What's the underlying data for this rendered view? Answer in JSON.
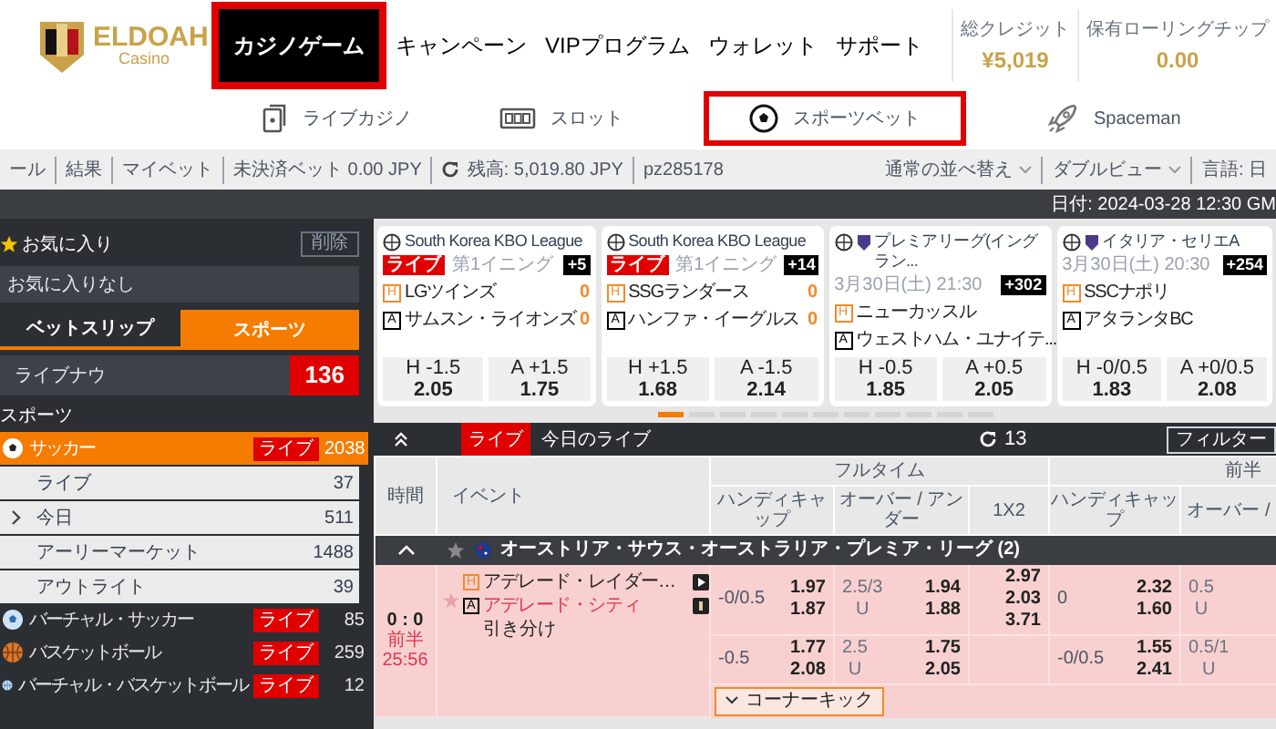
{
  "header": {
    "logo": {
      "name": "ELDOAH",
      "tagline": "Casino"
    },
    "nav": [
      {
        "label": "カジノゲーム",
        "selected": true
      },
      {
        "label": "キャンペーン",
        "selected": false
      },
      {
        "label": "VIPプログラム",
        "selected": false
      },
      {
        "label": "ウォレット",
        "selected": false
      },
      {
        "label": "サポート",
        "selected": false
      }
    ],
    "balances": [
      {
        "label": "総クレジット",
        "value": "¥5,019"
      },
      {
        "label": "保有ローリングチップ",
        "value": "0.00"
      }
    ]
  },
  "subnav": [
    {
      "kind": "live-casino",
      "label": "ライブカジノ",
      "selected": false
    },
    {
      "kind": "slot",
      "label": "スロット",
      "selected": false
    },
    {
      "kind": "sports",
      "label": "スポーツベット",
      "selected": true
    },
    {
      "kind": "rocket",
      "label": "Spaceman",
      "selected": false
    }
  ],
  "info_bar": {
    "left": [
      {
        "kind": "link",
        "text": "ール"
      },
      {
        "kind": "link",
        "text": "結果"
      },
      {
        "kind": "link",
        "text": "マイベット"
      },
      {
        "kind": "link",
        "text": "未決済ベット 0.00 JPY"
      },
      {
        "kind": "balance",
        "text": "残高: 5,019.80 JPY"
      },
      {
        "kind": "link",
        "text": "pz285178"
      }
    ],
    "right": [
      {
        "kind": "dropdown",
        "text": "通常の並べ替え"
      },
      {
        "kind": "dropdown",
        "text": "ダブルビュー"
      },
      {
        "kind": "link",
        "text": "言語: 日"
      }
    ]
  },
  "date_bar": "日付: 2024-03-28 12:30 GM",
  "sidebar": {
    "favorites": {
      "title": "お気に入り",
      "delete": "削除",
      "empty": "お気に入りなし"
    },
    "tabs": [
      {
        "label": "ベットスリップ",
        "selected": false
      },
      {
        "label": "スポーツ",
        "selected": true
      }
    ],
    "live_now": {
      "label": "ライブナウ",
      "count": "136"
    },
    "heading": "スポーツ",
    "sports": [
      {
        "kind": "soccer",
        "label": "サッカー",
        "live": "ライブ",
        "count": "2038",
        "selected": true,
        "children": [
          {
            "kind": "item",
            "label": "ライブ",
            "count": "37"
          },
          {
            "kind": "group",
            "label": "今日",
            "count": "511"
          },
          {
            "kind": "item",
            "label": "アーリーマーケット",
            "count": "1488"
          },
          {
            "kind": "item",
            "label": "アウトライト",
            "count": "39"
          }
        ]
      },
      {
        "kind": "virtual-soccer",
        "label": "バーチャル・サッカー",
        "live": "ライブ",
        "count": "85",
        "selected": false
      },
      {
        "kind": "basketball",
        "label": "バスケットボール",
        "live": "ライブ",
        "count": "259",
        "selected": false
      },
      {
        "kind": "virtual-basketball",
        "label": "バーチャル・バスケットボール",
        "live": "ライブ",
        "count": "12",
        "selected": false
      }
    ]
  },
  "cards": [
    {
      "kind": "live",
      "emblem": false,
      "league": "South Korea KBO League",
      "badge": "ライブ",
      "status": "第1イニング",
      "more": "+5",
      "teams": [
        {
          "mark": "H",
          "name": "LGツインズ",
          "score": "0"
        },
        {
          "mark": "A",
          "name": "サムスン・ライオンズ",
          "score": "0"
        }
      ],
      "odds": [
        {
          "label": "H -1.5",
          "value": "2.05"
        },
        {
          "label": "A +1.5",
          "value": "1.75"
        }
      ]
    },
    {
      "kind": "live",
      "emblem": false,
      "league": "South Korea KBO League",
      "badge": "ライブ",
      "status": "第1イニング",
      "more": "+14",
      "teams": [
        {
          "mark": "H",
          "name": "SSGランダース",
          "score": "0"
        },
        {
          "mark": "A",
          "name": "ハンファ・イーグルス",
          "score": "0"
        }
      ],
      "odds": [
        {
          "label": "H +1.5",
          "value": "1.68"
        },
        {
          "label": "A -1.5",
          "value": "2.14"
        }
      ]
    },
    {
      "kind": "scheduled",
      "emblem": true,
      "league": "プレミアリーグ(イングラン...",
      "status": "3月30日(土) 21:30",
      "more": "+302",
      "teams": [
        {
          "mark": "H",
          "name": "ニューカッスル"
        },
        {
          "mark": "A",
          "name": "ウェストハム・ユナイテ..."
        }
      ],
      "odds": [
        {
          "label": "H -0.5",
          "value": "1.85"
        },
        {
          "label": "A +0.5",
          "value": "2.05"
        }
      ]
    },
    {
      "kind": "scheduled",
      "emblem": true,
      "league": "イタリア・セリエA",
      "status": "3月30日(土) 20:30",
      "more": "+254",
      "teams": [
        {
          "mark": "H",
          "name": "SSCナポリ"
        },
        {
          "mark": "A",
          "name": "アタランタBC"
        }
      ],
      "odds": [
        {
          "label": "H -0/0.5",
          "value": "1.83"
        },
        {
          "label": "A +0/0.5",
          "value": "2.08"
        }
      ]
    }
  ],
  "pager": [
    {
      "selected": true
    },
    {
      "selected": false
    },
    {
      "selected": false
    },
    {
      "selected": false
    },
    {
      "selected": false
    },
    {
      "selected": false
    },
    {
      "selected": false
    },
    {
      "selected": false
    },
    {
      "selected": false
    },
    {
      "selected": false
    },
    {
      "selected": false
    }
  ],
  "live_table": {
    "badge": "ライブ",
    "title": "今日のライブ",
    "count": "13",
    "filter": "フィルター",
    "columns": [
      "時間",
      "イベント"
    ],
    "groups": [
      "フルタイム",
      "前半"
    ],
    "subcolumns": [
      "ハンディキャップ",
      "オーバー / アンダー",
      "1X2",
      "ハンディキャップ",
      "オーバー /"
    ],
    "league": {
      "name": "オーストリア・サウス・オーストラリア・プレミア・リーグ (2)",
      "expanded": true
    },
    "match": {
      "score": "0 : 0",
      "period": "前半",
      "clock": "25:56",
      "teams": [
        {
          "mark": "H",
          "name": "アデレード・レイダー…"
        },
        {
          "mark": "A",
          "name": "アデレード・シティ"
        }
      ],
      "draw": "引き分け",
      "extra": "コーナーキック",
      "lines": [
        {
          "ft_hdp": {
            "line": "-0/0.5",
            "odds": [
              "1.97",
              "1.87"
            ]
          },
          "ft_ou": {
            "line": [
              "2.5/3",
              "U"
            ],
            "odds": [
              "1.94",
              "1.88"
            ]
          },
          "ft_1x2": [
            "2.97",
            "2.03",
            "3.71"
          ],
          "h1_hdp": {
            "line": "0",
            "odds": [
              "2.32",
              "1.60"
            ]
          },
          "h1_ou": {
            "line": [
              "0.5",
              "U"
            ]
          }
        },
        {
          "ft_hdp": {
            "line": "-0.5",
            "odds": [
              "1.77",
              "2.08"
            ]
          },
          "ft_ou": {
            "line": [
              "2.5",
              "U"
            ],
            "odds": [
              "1.75",
              "2.05"
            ]
          },
          "h1_hdp": {
            "line": "-0/0.5",
            "odds": [
              "1.55",
              "2.41"
            ]
          },
          "h1_ou": {
            "line": [
              "0.5/1",
              "U"
            ]
          }
        }
      ]
    }
  }
}
